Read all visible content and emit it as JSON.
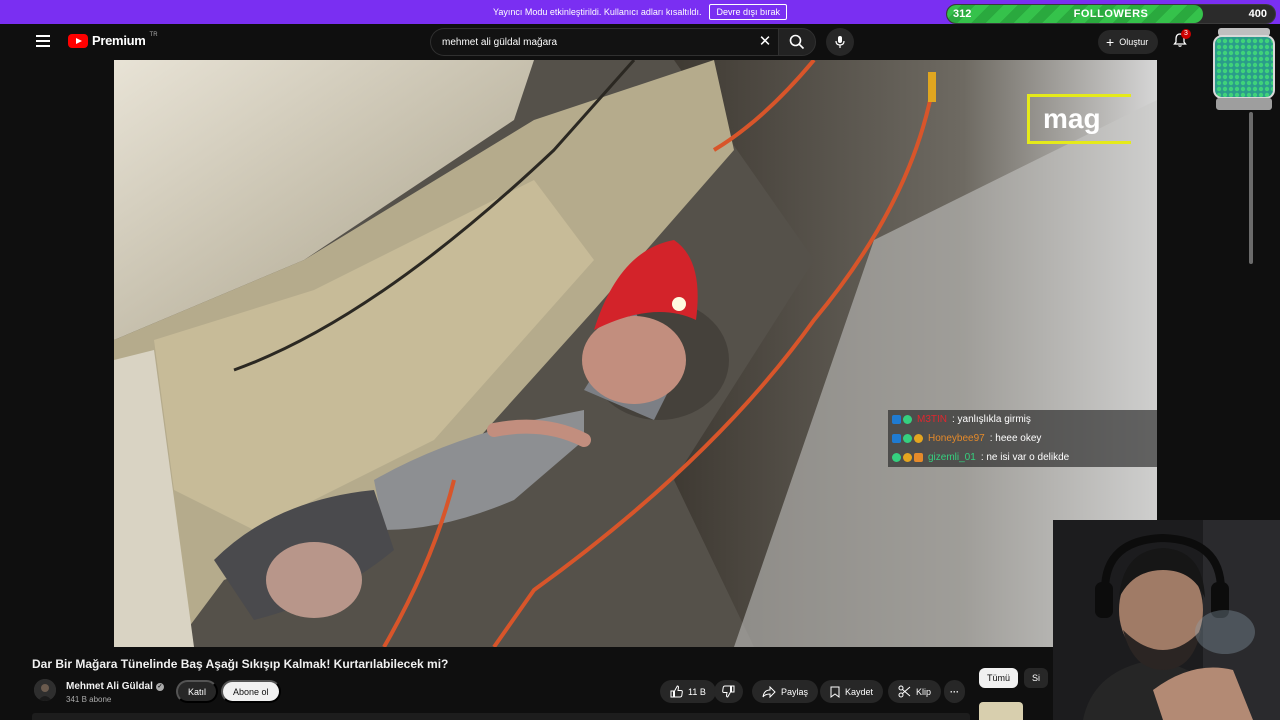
{
  "banner": {
    "message": "Yayıncı Modu etkinleştirildi. Kullanıcı adları kısaltıldı.",
    "button_label": "Devre dışı bırak"
  },
  "followers_goal": {
    "current": "312",
    "label": "FOLLOWERS",
    "target": "400",
    "progress_fraction": 0.78
  },
  "header": {
    "logo_text": "Premium",
    "logo_region": "TR",
    "search_value": "mehmet ali güldal mağara",
    "create_label": "Oluştur",
    "notification_count": "3"
  },
  "player_overlay": {
    "mag_text": "mag",
    "chat": [
      {
        "user": "M3TIN",
        "user_color": "#e0262e",
        "message": ": yanlışlıkla girmiş"
      },
      {
        "user": "Honeybee97",
        "user_color": "#e58a2a",
        "message": ": heee okey"
      },
      {
        "user": "gizemli_01",
        "user_color": "#35d07f",
        "message": ": ne isi var o delikde"
      }
    ]
  },
  "video": {
    "title": "Dar Bir Mağara Tünelinde Baş Aşağı Sıkışıp Kalmak! Kurtarılabilecek mi?",
    "channel_name": "Mehmet Ali Güldal",
    "subscribers": "341 B abone",
    "join_label": "Katıl",
    "subscribe_label": "Abone ol",
    "like_count": "11 B",
    "share_label": "Paylaş",
    "save_label": "Kaydet",
    "clip_label": "Klip",
    "more_label": "···"
  },
  "chips": {
    "all_label": "Tümü",
    "second_label": "Si"
  },
  "colors": {
    "banner": "#7a2ff2",
    "youtube_red": "#ff0000",
    "goal_green": "#35c24b",
    "mag_border": "#e5ea1a"
  }
}
